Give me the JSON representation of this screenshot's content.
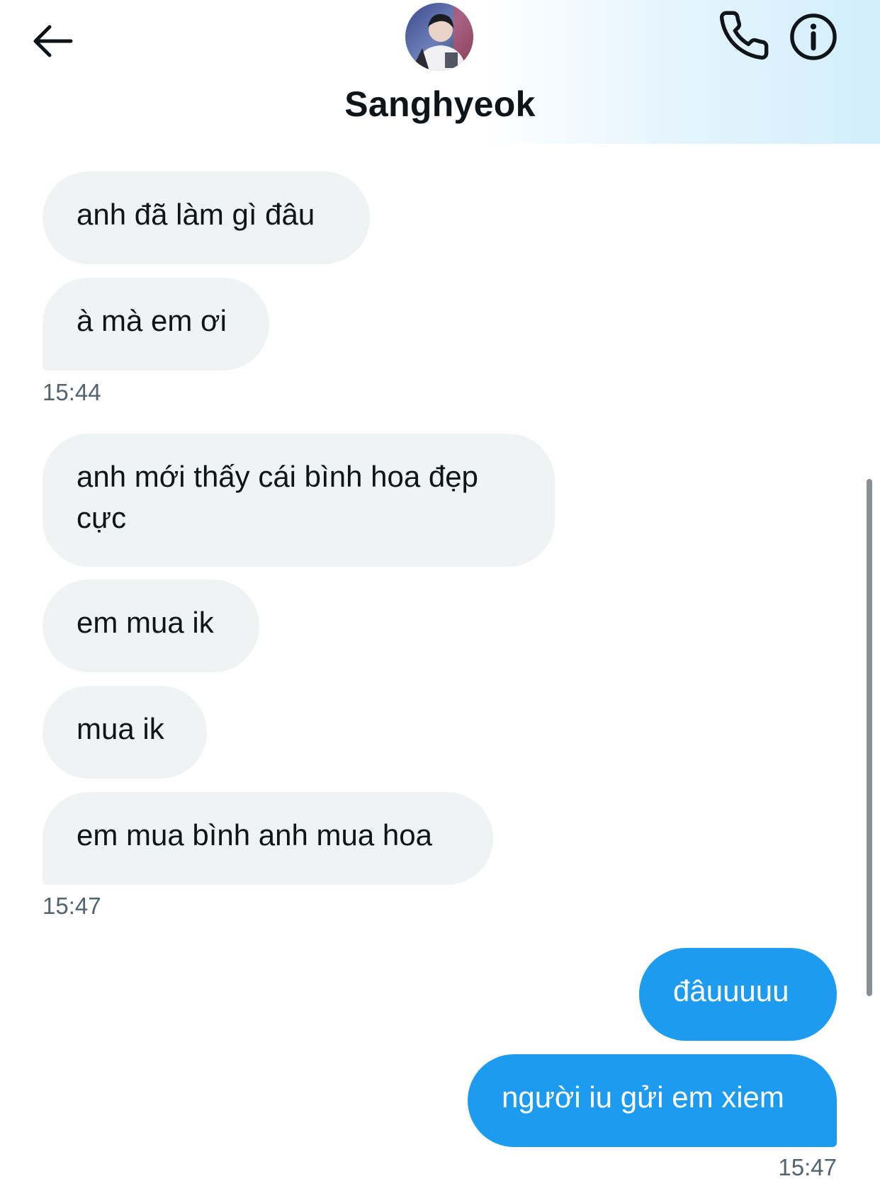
{
  "header": {
    "contact_name": "Sanghyeok",
    "icons": {
      "back": "arrow-left-icon",
      "call": "phone-icon",
      "info": "info-icon"
    }
  },
  "messages": [
    {
      "text": "anh đã làm gì đâu",
      "direction": "received"
    },
    {
      "text": "à mà em ơi",
      "direction": "received"
    },
    {
      "text": "anh mới thấy cái bình hoa đẹp cực",
      "direction": "received"
    },
    {
      "text": "em mua ik",
      "direction": "received"
    },
    {
      "text": "mua ik",
      "direction": "received"
    },
    {
      "text": "em mua bình anh mua hoa",
      "direction": "received"
    },
    {
      "text": "đâuuuuu",
      "direction": "sent"
    },
    {
      "text": "người iu gửi em xiem",
      "direction": "sent"
    }
  ],
  "timestamps": [
    "15:44",
    "15:47",
    "15:47"
  ],
  "colors": {
    "sent_bubble": "#1d9bf0",
    "received_bubble": "#eff3f4",
    "timestamp": "#536471",
    "text": "#0f1419"
  }
}
